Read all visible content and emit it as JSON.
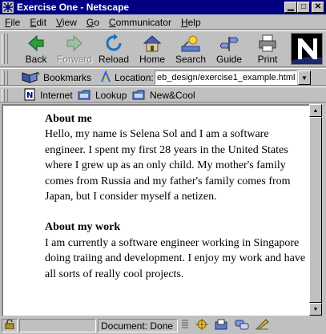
{
  "window": {
    "title": "Exercise One - Netscape",
    "app_icon": "netscape-icon",
    "buttons": [
      "minimize",
      "maximize",
      "close"
    ]
  },
  "menu": {
    "items": [
      {
        "label": "File",
        "accel": "F"
      },
      {
        "label": "Edit",
        "accel": "E"
      },
      {
        "label": "View",
        "accel": "V"
      },
      {
        "label": "Go",
        "accel": "G"
      },
      {
        "label": "Communicator",
        "accel": "C"
      },
      {
        "label": "Help",
        "accel": "H"
      }
    ]
  },
  "toolbar": {
    "back": "Back",
    "forward": "Forward",
    "reload": "Reload",
    "home": "Home",
    "search": "Search",
    "guide": "Guide",
    "print": "Print",
    "forward_disabled": true
  },
  "location": {
    "bookmarks_label": "Bookmarks",
    "location_label": "Location:",
    "url": "eb_design/exercise1_example.html"
  },
  "personal_toolbar": {
    "items": [
      "Internet",
      "Lookup",
      "New&Cool"
    ]
  },
  "content": {
    "heading1": "About me",
    "para1": "Hello, my name is Selena Sol and I am a software engineer. I spent my first 28 years in the United States where I grew up as an only child. My mother's family comes from Russia and my father's family comes from Japan, but I consider myself a netizen.",
    "heading2": "About my work",
    "para2": "I am currently a software engineer working in Singapore doing traiing and development. I enjoy my work and have all sorts of really cool projects."
  },
  "status": {
    "text": "Document: Done"
  },
  "colors": {
    "titlebar": "#000080",
    "chrome": "#c0c0c0",
    "page_background": "#ffffff"
  }
}
